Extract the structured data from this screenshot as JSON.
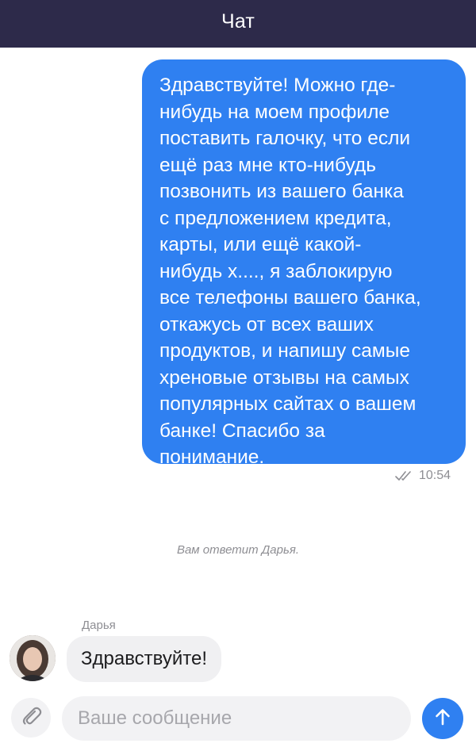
{
  "header": {
    "title": "Чат"
  },
  "messages": [
    {
      "direction": "outgoing",
      "text": "Здравствуйте! Можно где-\nнибудь на моем профиле\nпоставить галочку, что если\nещё раз мне кто-нибудь\nпозвонить из вашего банка\nс предложением кредита,\nкарты, или ещё какой-\nнибудь х...., я заблокирую\nвсе телефоны вашего банка,\nоткажусь от всех ваших\nпродуктов, и напишу самые\nхреновые отзывы на самых\nпопулярных сайтах о вашем\nбанке! Спасибо за\nпонимание.",
      "time": "10:54",
      "status_icon": "double-check-icon"
    },
    {
      "direction": "incoming",
      "sender": "Дарья",
      "text": "Здравствуйте!",
      "avatar_icon": "avatar"
    }
  ],
  "system_note": "Вам ответит Дарья.",
  "composer": {
    "placeholder": "Ваше сообщение",
    "value": "",
    "attach_icon": "paperclip-icon",
    "send_icon": "arrow-up-icon"
  },
  "colors": {
    "header_bg": "#2d2a4a",
    "accent": "#2f80f1",
    "incoming_bubble": "#f0f0f2",
    "muted_text": "#8e8e93"
  }
}
